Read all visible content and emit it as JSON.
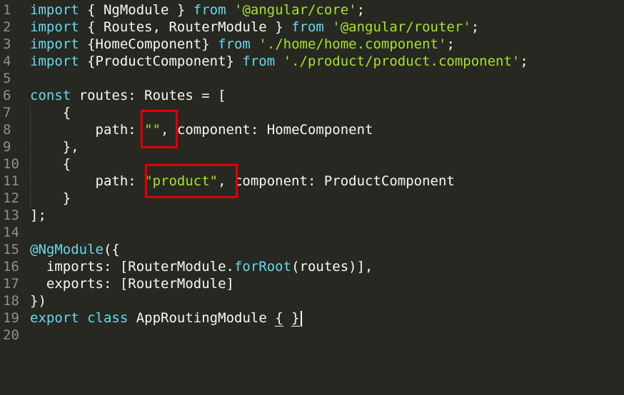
{
  "editor": {
    "language": "typescript",
    "colors": {
      "background": "#272822",
      "keyword": "#66d9ef",
      "string": "#a6e22e",
      "text": "#f8f8f2",
      "gutter": "#8f908a",
      "highlight_box": "#e00000"
    },
    "lines": [
      {
        "num": "1"
      },
      {
        "num": "2"
      },
      {
        "num": "3"
      },
      {
        "num": "4"
      },
      {
        "num": "5"
      },
      {
        "num": "6"
      },
      {
        "num": "7"
      },
      {
        "num": "8"
      },
      {
        "num": "9"
      },
      {
        "num": "10"
      },
      {
        "num": "11"
      },
      {
        "num": "12"
      },
      {
        "num": "13"
      },
      {
        "num": "14"
      },
      {
        "num": "15"
      },
      {
        "num": "16"
      },
      {
        "num": "17"
      },
      {
        "num": "18"
      },
      {
        "num": "19"
      },
      {
        "num": "20"
      }
    ],
    "tokens": {
      "import": "import",
      "from": "from",
      "const": "const",
      "export": "export",
      "class": "class",
      "l1_mid": " { NgModule } ",
      "l1_str": "'@angular/core'",
      "l1_end": ";",
      "l2_mid": " { Routes, RouterModule } ",
      "l2_str": "'@angular/router'",
      "l2_end": ";",
      "l3_mid": " {HomeComponent} ",
      "l3_str": "'./home/home.component'",
      "l3_end": ";",
      "l4_mid": " {ProductComponent} ",
      "l4_str": "'./product/product.component'",
      "l4_end": ";",
      "l6_rest": " routes: Routes = [",
      "l7": "    {",
      "l8_pre": "        path: ",
      "l8_str": "\"\"",
      "l8_rest": ", component: HomeComponent",
      "l9": "    },",
      "l10": "    {",
      "l11_pre": "        path: ",
      "l11_str": "\"product\"",
      "l11_rest": ", component: ProductComponent",
      "l12": "    }",
      "l13": "];",
      "l15_dec": "@NgModule",
      "l15_rest": "({",
      "l16_pre": "  imports: [RouterModule.",
      "l16_fn": "forRoot",
      "l16_rest": "(routes)],",
      "l17": "  exports: [RouterModule]",
      "l18": "})",
      "l19_name": " AppRoutingModule ",
      "l19_open": "{",
      "l19_close": "}"
    }
  }
}
